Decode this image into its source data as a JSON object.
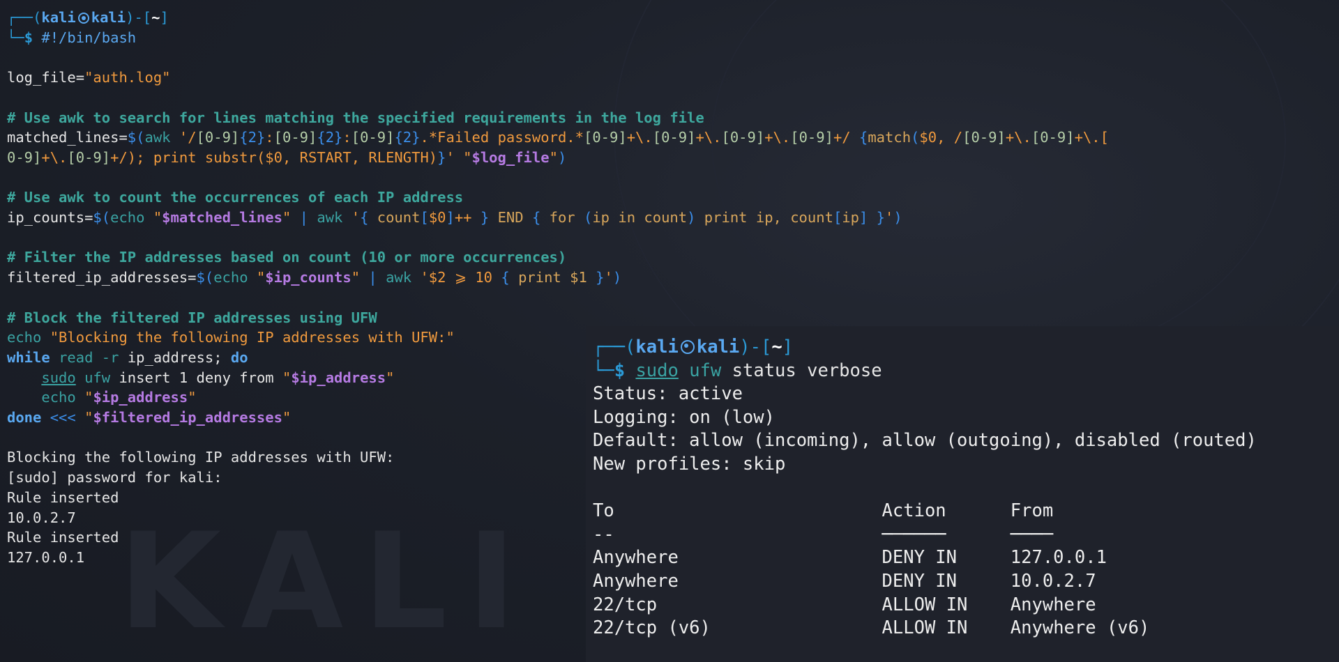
{
  "watermark": "KALI",
  "prompt": {
    "user": "kali",
    "host": "kali",
    "dir": "~",
    "symbol": "$"
  },
  "script": {
    "command": "#!/bin/bash",
    "line_logfile": "log_file=\"auth.log\"",
    "comment1": "# Use awk to search for lines matching the specified requirements in the log file",
    "line_matched_1": "matched_lines=$(awk '/[0-9]{2}:[0-9]{2}:[0-9]{2}.*Failed password.*[0-9]+\\.[0-9]+\\.[0-9]+\\.[0-9]+/ {match($0, /[0-9]+\\.[0-9]+\\.[",
    "line_matched_2": "0-9]+\\.[0-9]+/); print substr($0, RSTART, RLENGTH)}' \"$log_file\")",
    "comment2": "# Use awk to count the occurrences of each IP address",
    "line_ipcounts": "ip_counts=$(echo \"$matched_lines\" | awk '{ count[$0]++ } END { for (ip in count) print ip, count[ip] }')",
    "comment3": "# Filter the IP addresses based on count (10 or more occurrences)",
    "line_filtered": "filtered_ip_addresses=$(echo \"$ip_counts\" | awk '$2 ⩾ 10 { print $1 }')",
    "comment4": "# Block the filtered IP addresses using UFW",
    "line_echo": "echo \"Blocking the following IP addresses with UFW:\"",
    "line_while": "while read -r ip_address; do",
    "line_sudo": "    sudo ufw insert 1 deny from \"$ip_address\"",
    "line_echo_ip": "    echo \"$ip_address\"",
    "line_done": "done <<< \"$filtered_ip_addresses\""
  },
  "output": [
    "Blocking the following IP addresses with UFW:",
    "[sudo] password for kali:",
    "Rule inserted",
    "10.0.2.7",
    "Rule inserted",
    "127.0.0.1"
  ],
  "terminal2": {
    "command_sudo": "sudo",
    "command_ufw": "ufw",
    "command_args": "status verbose",
    "status": "Status: active",
    "logging": "Logging: on (low)",
    "default": "Default: allow (incoming), allow (outgoing), disabled (routed)",
    "profiles": "New profiles: skip",
    "columns": [
      "To",
      "Action",
      "From"
    ],
    "separators": [
      "--",
      "──────",
      "────"
    ],
    "rules": [
      {
        "to": "Anywhere",
        "action": "DENY IN",
        "from": "127.0.0.1"
      },
      {
        "to": "Anywhere",
        "action": "DENY IN",
        "from": "10.0.2.7"
      },
      {
        "to": "22/tcp",
        "action": "ALLOW IN",
        "from": "Anywhere"
      },
      {
        "to": "22/tcp (v6)",
        "action": "ALLOW IN",
        "from": "Anywhere (v6)"
      }
    ]
  }
}
